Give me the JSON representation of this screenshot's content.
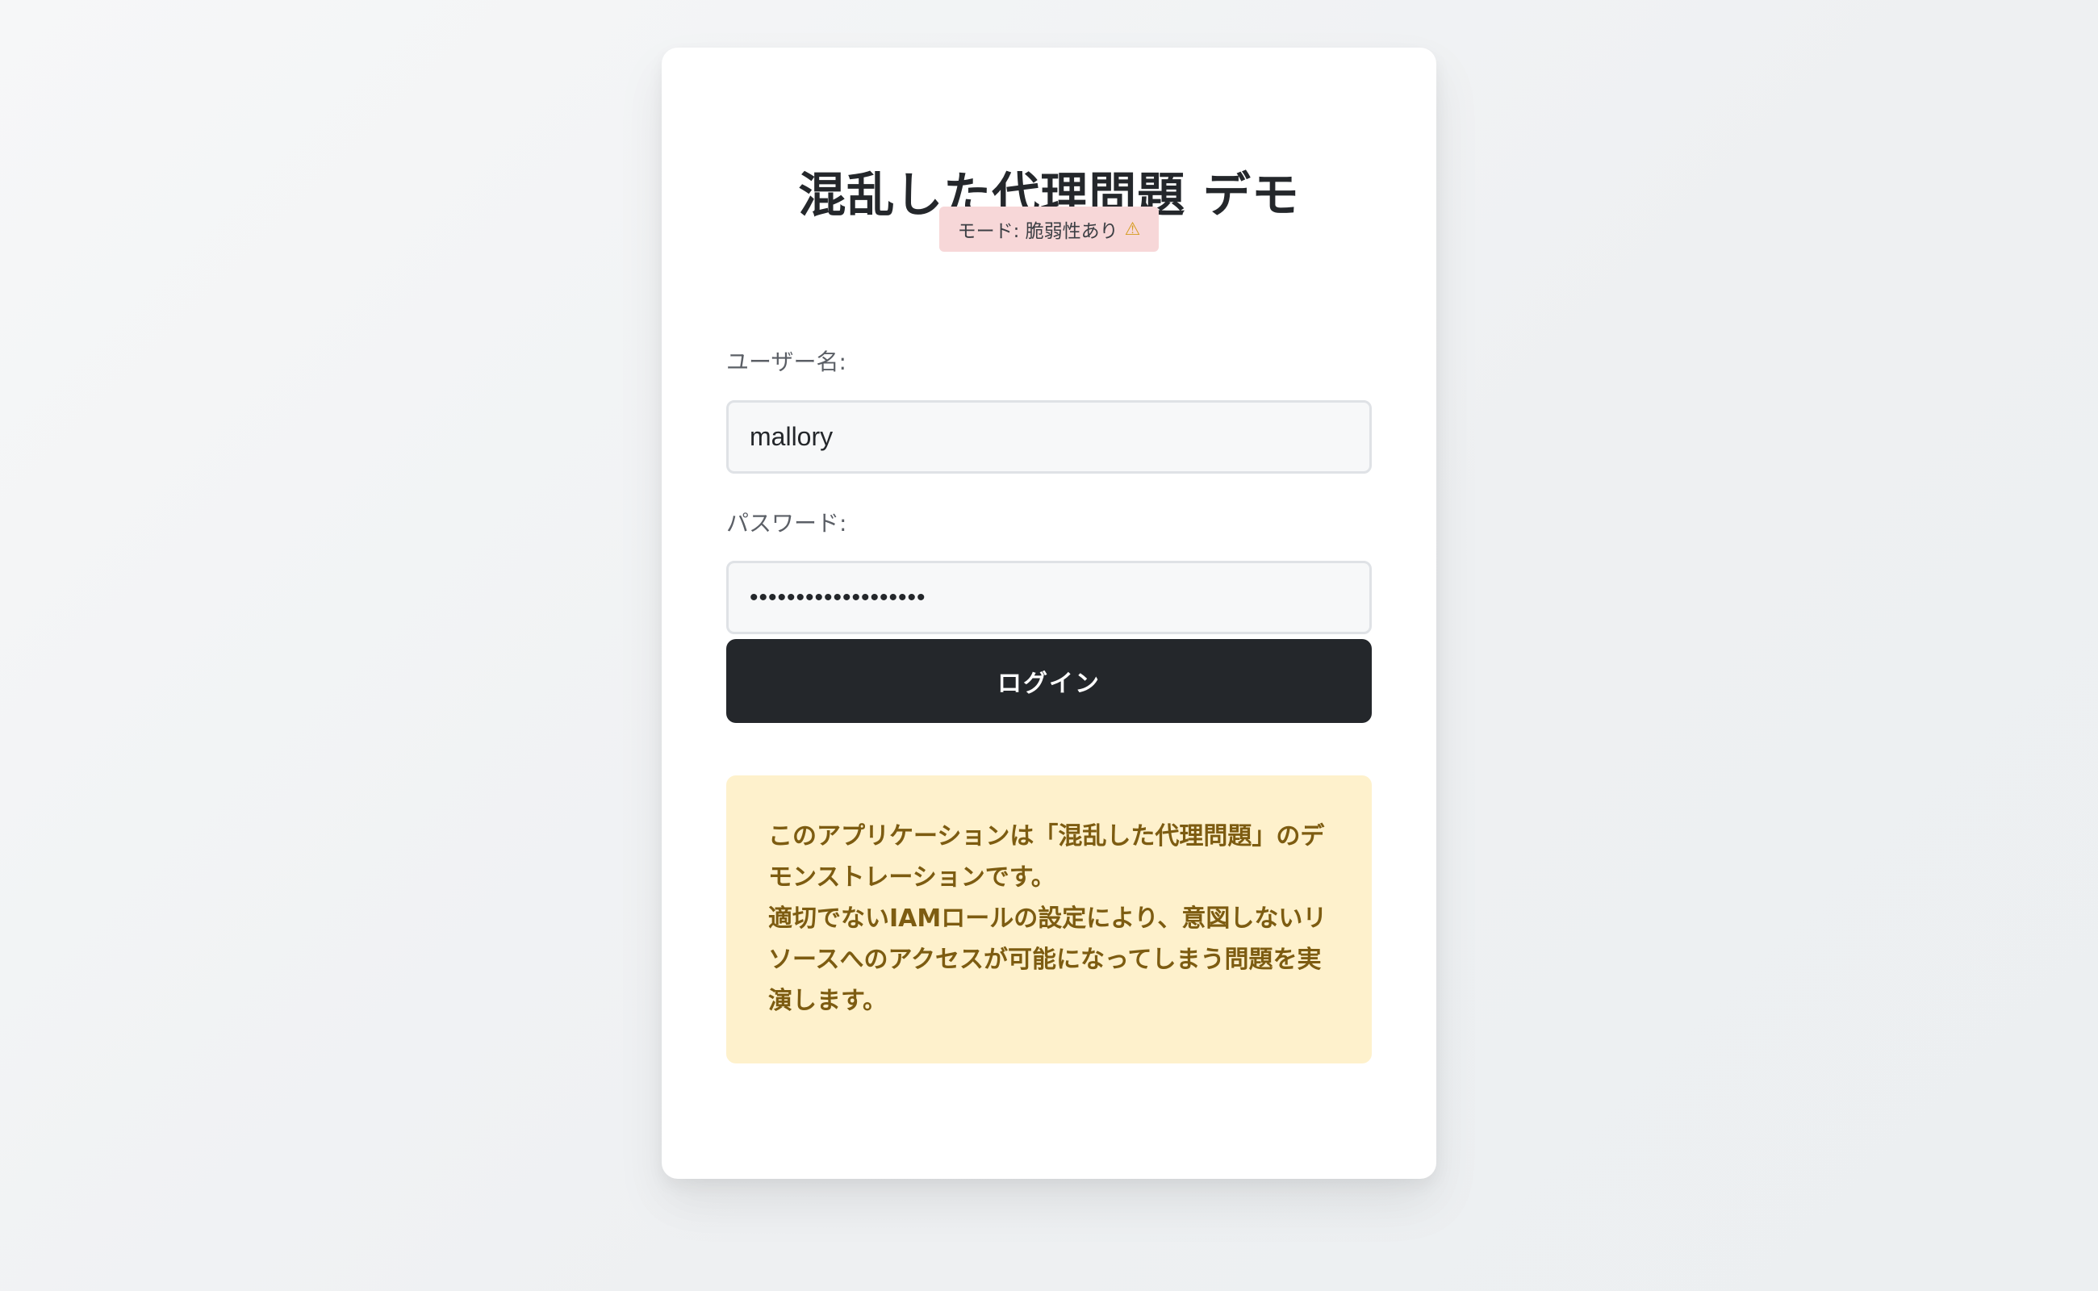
{
  "title": "混乱した代理問題 デモ",
  "mode_badge": {
    "text": "モード: 脆弱性あり",
    "icon": "warning-icon",
    "color": "#f7d7d8"
  },
  "form": {
    "username": {
      "label": "ユーザー名:",
      "value": "mallory"
    },
    "password": {
      "label": "パスワード:",
      "value": "•••••••••••••••••••"
    },
    "login_button_label": "ログイン"
  },
  "info": {
    "line1": "このアプリケーションは「混乱した代理問題」のデモンストレーションです。",
    "line2": "適切でないIAMロールの設定により、意図しないリソースへのアクセスが可能になってしまう問題を実演します。"
  },
  "colors": {
    "accent": "#24272b",
    "info_background": "#fef1cc",
    "info_text": "#7d5c11",
    "badge_background": "#f7d7d8"
  }
}
